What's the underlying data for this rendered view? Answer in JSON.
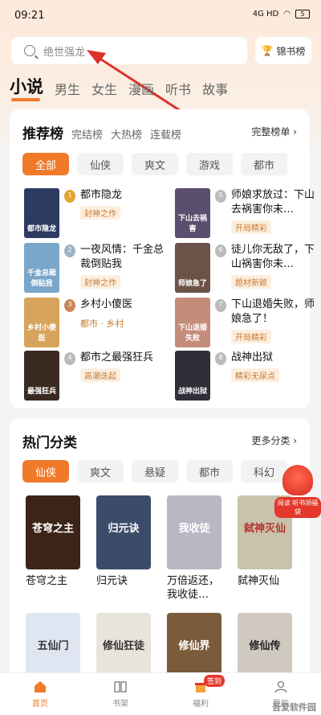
{
  "status": {
    "time": "09:21",
    "network": "4G HD",
    "battery": "5"
  },
  "search": {
    "placeholder": "绝世强龙"
  },
  "rank_button": {
    "label": "锦书榜"
  },
  "top_tabs": [
    "小说",
    "男生",
    "女生",
    "漫画",
    "听书",
    "故事"
  ],
  "recommend": {
    "title": "推荐榜",
    "subtabs": [
      "完结榜",
      "大热榜",
      "连载榜"
    ],
    "more": "完整榜单 ›",
    "chips": [
      "全部",
      "仙侠",
      "爽文",
      "游戏",
      "都市"
    ],
    "books": [
      {
        "rank": "1",
        "name": "都市隐龙",
        "tag": "封神之作",
        "cover_text": "都市隐龙",
        "cover_color": "#2d3b63"
      },
      {
        "rank": "2",
        "name": "一夜风情：千金总裁倒贴我",
        "tag": "封神之作",
        "cover_text": "千金总裁倒贴我",
        "cover_color": "#7aa6c9"
      },
      {
        "rank": "3",
        "name": "乡村小傻医",
        "meta": "都市 · 乡村",
        "cover_text": "乡村小傻医",
        "cover_color": "#d6a45c"
      },
      {
        "rank": "4",
        "name": "都市之最强狂兵",
        "tag": "高潮迭起",
        "cover_text": "最强狂兵",
        "cover_color": "#3a2a22"
      },
      {
        "rank": "5",
        "name": "师娘求放过：下山去祸害你未…",
        "tag": "开局精彩",
        "cover_text": "下山去祸害",
        "cover_color": "#5b4f6f"
      },
      {
        "rank": "6",
        "name": "徒儿你无敌了，下山祸害你未…",
        "tag": "题材新颖",
        "cover_text": "师娘急了",
        "cover_color": "#6b5348"
      },
      {
        "rank": "7",
        "name": "下山退婚失败，师娘急了！",
        "tag": "开局精彩",
        "cover_text": "下山退婚失败",
        "cover_color": "#c48c7a"
      },
      {
        "rank": "8",
        "name": "战神出狱",
        "tag": "精彩无尿点",
        "cover_text": "战神出狱",
        "cover_color": "#2f2f3a"
      }
    ]
  },
  "hot": {
    "title": "热门分类",
    "more": "更多分类 ›",
    "chips": [
      "仙侠",
      "爽文",
      "悬疑",
      "都市",
      "科幻"
    ],
    "books": [
      {
        "name": "苍穹之主",
        "cover_text": "苍穹之主",
        "cover_color": "#3b2418"
      },
      {
        "name": "归元诀",
        "cover_text": "归元诀",
        "cover_color": "#3b4c6a"
      },
      {
        "name": "万倍返还，我收徒…",
        "cover_text": "我收徒",
        "cover_color": "#b9b7c4"
      },
      {
        "name": "弑神灭仙",
        "cover_text": "弑神灭仙",
        "cover_color": "#c9c2ad"
      },
      {
        "name": "",
        "cover_text": "五仙门",
        "cover_color": "#dfe6f2"
      },
      {
        "name": "",
        "cover_text": "修仙狂徒",
        "cover_color": "#e8e4dc"
      },
      {
        "name": "",
        "cover_text": "修仙界",
        "cover_color": "#7b5b3a"
      },
      {
        "name": "",
        "cover_text": "修仙传",
        "cover_color": "#cfc9c0"
      }
    ]
  },
  "gift": {
    "label": "阅读 听书领福袋"
  },
  "tabbar": {
    "items": [
      "首页",
      "书架",
      "福利",
      "我的"
    ],
    "badge": "签到"
  },
  "watermark": "吾爱软件园"
}
